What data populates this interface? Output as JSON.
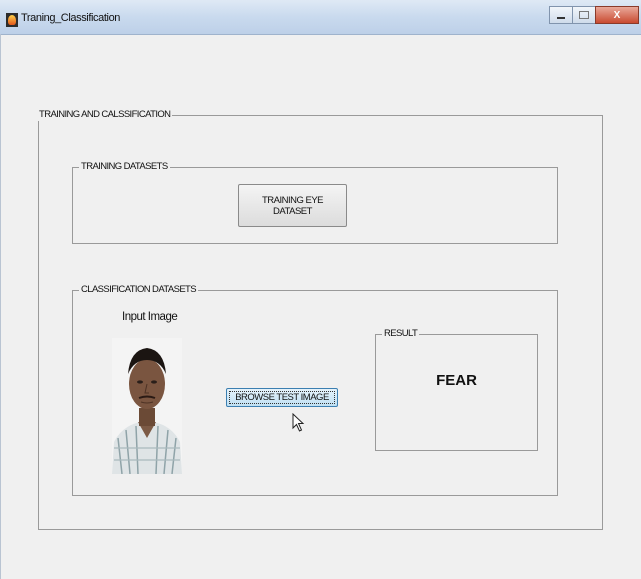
{
  "window": {
    "title": "Traning_Classification",
    "controls": {
      "minimize": "minimize",
      "maximize": "maximize",
      "close": "X"
    }
  },
  "panels": {
    "outer_title": "TRAINING AND CALSSIFICATION",
    "training": {
      "title": "TRAINING DATASETS",
      "button_label": "TRAINING EYE DATASET"
    },
    "classification": {
      "title": "CLASSIFICATION DATASETS",
      "input_label": "Input Image",
      "browse_label": "BROWSE TEST IMAGE",
      "result": {
        "title": "RESULT",
        "value": "FEAR"
      }
    }
  },
  "icons": [
    "app-icon",
    "minimize-icon",
    "maximize-icon",
    "close-icon",
    "mouse-cursor-icon"
  ]
}
